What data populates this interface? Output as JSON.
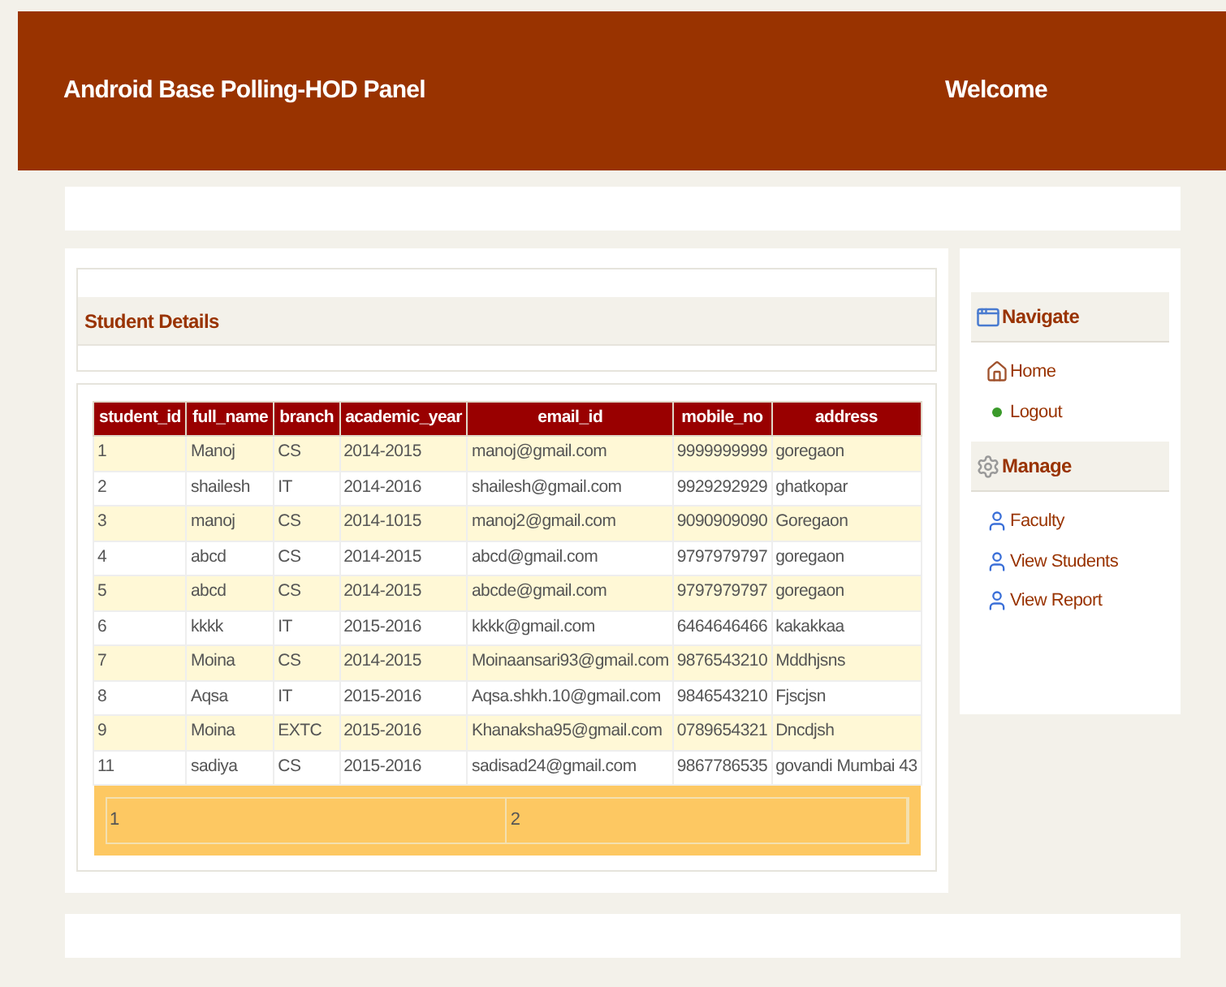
{
  "header": {
    "title": "Android Base Polling-HOD Panel",
    "welcome": "Welcome"
  },
  "section_title": "Student Details",
  "table": {
    "columns": [
      "student_id",
      "full_name",
      "branch",
      "academic_year",
      "email_id",
      "mobile_no",
      "address"
    ],
    "rows": [
      [
        "1",
        "Manoj",
        "CS",
        "2014-2015",
        "manoj@gmail.com",
        "9999999999",
        "goregaon"
      ],
      [
        "2",
        "shailesh",
        "IT",
        "2014-2016",
        "shailesh@gmail.com",
        "9929292929",
        "ghatkopar"
      ],
      [
        "3",
        "manoj",
        "CS",
        "2014-1015",
        "manoj2@gmail.com",
        "9090909090",
        "Goregaon"
      ],
      [
        "4",
        "abcd",
        "CS",
        "2014-2015",
        "abcd@gmail.com",
        "9797979797",
        "goregaon"
      ],
      [
        "5",
        "abcd",
        "CS",
        "2014-2015",
        "abcde@gmail.com",
        "9797979797",
        "goregaon"
      ],
      [
        "6",
        "kkkk",
        "IT",
        "2015-2016",
        "kkkk@gmail.com",
        "6464646466",
        "kakakkaa"
      ],
      [
        "7",
        "Moina",
        "CS",
        "2014-2015",
        "Moinaansari93@gmail.com",
        "9876543210",
        "Mddhjsns"
      ],
      [
        "8",
        "Aqsa",
        "IT",
        "2015-2016",
        "Aqsa.shkh.10@gmail.com",
        "9846543210",
        "Fjscjsn"
      ],
      [
        "9",
        "Moina",
        "EXTC",
        "2015-2016",
        "Khanaksha95@gmail.com",
        "0789654321",
        "Dncdjsh"
      ],
      [
        "11",
        "sadiya",
        "CS",
        "2015-2016",
        "sadisad24@gmail.com",
        "9867786535",
        "govandi Mumbai 43"
      ]
    ],
    "pages": [
      "1",
      "2"
    ]
  },
  "sidebar": [
    {
      "title": "Navigate",
      "kind": "window",
      "items": [
        {
          "label": "Home",
          "kind": "home"
        },
        {
          "label": "Logout",
          "kind": "dot"
        }
      ]
    },
    {
      "title": "Manage",
      "kind": "gear",
      "items": [
        {
          "label": "Faculty",
          "kind": "user"
        },
        {
          "label": "View Students",
          "kind": "user"
        },
        {
          "label": "View Report",
          "kind": "user"
        }
      ]
    }
  ]
}
